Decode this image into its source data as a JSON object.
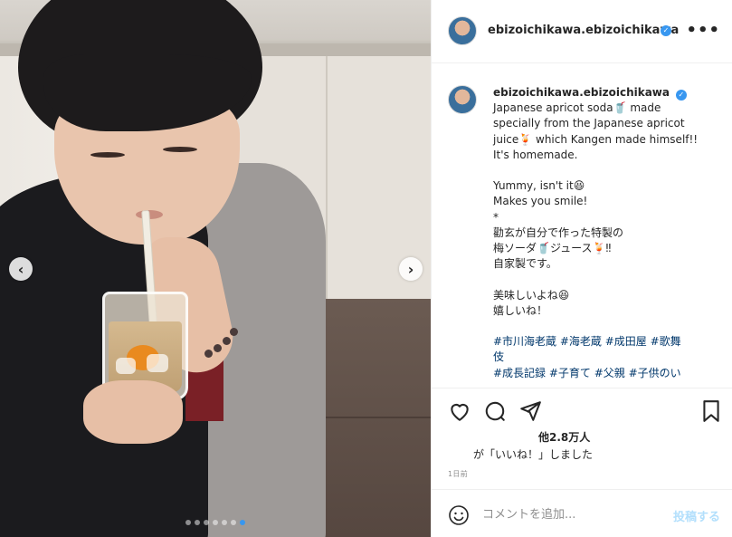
{
  "post": {
    "username": "ebizoichikawa.ebizoichikawa",
    "more_icon": "more-horizontal-icon",
    "verified_icon": "verified-badge-icon",
    "verified_color": "#3897f0"
  },
  "caption": {
    "username": "ebizoichikawa.ebizoichikawa",
    "lines": [
      "Japanese apricot soda🥤 made",
      "specially from the Japanese apricot",
      "juice🍹 which Kangen made himself!!",
      "It's homemade.",
      "",
      "Yummy, isn't it😆",
      "Makes you smile!",
      "*",
      "勸玄が自分で作った特製の",
      "梅ソーダ🥤ジュース🍹‼︎",
      "自家製です。",
      "",
      "美味しいよね😆",
      "嬉しいね！",
      ""
    ],
    "hashtags": [
      "#市川海老蔵 #海老蔵 #成田屋 #歌舞",
      "伎",
      "#成長記録 #子育て #父親 #子供のい"
    ]
  },
  "carousel": {
    "prev_icon": "chevron-left-icon",
    "next_icon": "chevron-right-icon",
    "prev_glyph": "‹",
    "next_glyph": "›",
    "dot_count": 7,
    "active_index": 6,
    "active_color": "#3897f0"
  },
  "actions": {
    "icons": [
      "heart-icon",
      "comment-icon",
      "share-icon",
      "bookmark-icon"
    ],
    "likes_count": "他2.8万人",
    "likes_text": "が「いいね！」しました",
    "timestamp": "1日前"
  },
  "comment": {
    "emoji_icon": "smiley-face-icon",
    "placeholder": "コメントを追加...",
    "post_label": "投稿する",
    "post_color": "#b2dffc"
  }
}
